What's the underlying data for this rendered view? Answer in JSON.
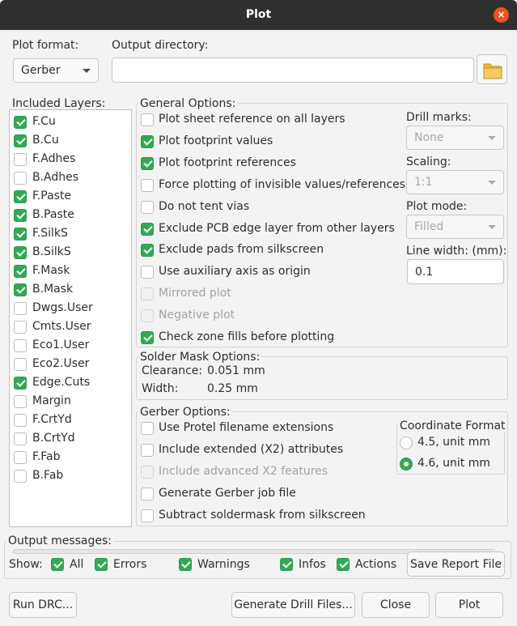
{
  "window": {
    "title": "Plot",
    "close_glyph": "×"
  },
  "plot_format": {
    "label": "Plot format:",
    "value": "Gerber"
  },
  "output_directory": {
    "label": "Output directory:",
    "value": "",
    "browse_icon": "folder-icon"
  },
  "layers": {
    "title": "Included Layers:",
    "items": [
      {
        "label": "F.Cu",
        "checked": true
      },
      {
        "label": "B.Cu",
        "checked": true
      },
      {
        "label": "F.Adhes",
        "checked": false
      },
      {
        "label": "B.Adhes",
        "checked": false
      },
      {
        "label": "F.Paste",
        "checked": true
      },
      {
        "label": "B.Paste",
        "checked": true
      },
      {
        "label": "F.SilkS",
        "checked": true
      },
      {
        "label": "B.SilkS",
        "checked": true
      },
      {
        "label": "F.Mask",
        "checked": true
      },
      {
        "label": "B.Mask",
        "checked": true
      },
      {
        "label": "Dwgs.User",
        "checked": false
      },
      {
        "label": "Cmts.User",
        "checked": false
      },
      {
        "label": "Eco1.User",
        "checked": false
      },
      {
        "label": "Eco2.User",
        "checked": false
      },
      {
        "label": "Edge.Cuts",
        "checked": true
      },
      {
        "label": "Margin",
        "checked": false
      },
      {
        "label": "F.CrtYd",
        "checked": false
      },
      {
        "label": "B.CrtYd",
        "checked": false
      },
      {
        "label": "F.Fab",
        "checked": false
      },
      {
        "label": "B.Fab",
        "checked": false
      }
    ]
  },
  "general": {
    "title": "General Options:",
    "options": [
      {
        "label": "Plot sheet reference on all layers",
        "checked": false,
        "enabled": true
      },
      {
        "label": "Plot footprint values",
        "checked": true,
        "enabled": true
      },
      {
        "label": "Plot footprint references",
        "checked": true,
        "enabled": true
      },
      {
        "label": "Force plotting of invisible values/references",
        "checked": false,
        "enabled": true
      },
      {
        "label": "Do not tent vias",
        "checked": false,
        "enabled": true
      },
      {
        "label": "Exclude PCB edge layer from other layers",
        "checked": true,
        "enabled": true
      },
      {
        "label": "Exclude pads from silkscreen",
        "checked": true,
        "enabled": true
      },
      {
        "label": "Use auxiliary axis as origin",
        "checked": false,
        "enabled": true
      },
      {
        "label": "Mirrored plot",
        "checked": false,
        "enabled": false
      },
      {
        "label": "Negative plot",
        "checked": false,
        "enabled": false
      },
      {
        "label": "Check zone fills before plotting",
        "checked": true,
        "enabled": true
      }
    ],
    "drill_marks": {
      "label": "Drill marks:",
      "value": "None"
    },
    "scaling": {
      "label": "Scaling:",
      "value": "1:1"
    },
    "plot_mode": {
      "label": "Plot mode:",
      "value": "Filled"
    },
    "line_width": {
      "label": "Line width: (mm):",
      "value": "0.1"
    }
  },
  "solder_mask": {
    "title": "Solder Mask Options:",
    "clearance_label": "Clearance:",
    "clearance_value": "0.051 mm",
    "width_label": "Width:",
    "width_value": "0.25 mm"
  },
  "gerber": {
    "title": "Gerber Options:",
    "options": [
      {
        "label": "Use Protel filename extensions",
        "checked": false,
        "enabled": true
      },
      {
        "label": "Include extended (X2) attributes",
        "checked": false,
        "enabled": true
      },
      {
        "label": "Include advanced X2 features",
        "checked": false,
        "enabled": false
      },
      {
        "label": "Generate Gerber job file",
        "checked": false,
        "enabled": true
      },
      {
        "label": "Subtract soldermask from silkscreen",
        "checked": false,
        "enabled": true
      }
    ],
    "coord_format": {
      "title": "Coordinate Format",
      "options": [
        {
          "label": "4.5, unit mm",
          "selected": false
        },
        {
          "label": "4.6, unit mm",
          "selected": true
        }
      ]
    }
  },
  "messages": {
    "title": "Output messages:",
    "show_label": "Show:",
    "filters": [
      {
        "label": "All",
        "checked": true
      },
      {
        "label": "Errors",
        "checked": true
      },
      {
        "label": "Warnings",
        "checked": true
      },
      {
        "label": "Infos",
        "checked": true
      },
      {
        "label": "Actions",
        "checked": true
      }
    ],
    "save_button": "Save Report File"
  },
  "buttons": {
    "run_drc": "Run DRC...",
    "generate_drill": "Generate Drill Files...",
    "close": "Close",
    "plot": "Plot"
  },
  "colors": {
    "accent": "#33a956",
    "titlebar": "#2f2f2f",
    "close": "#e9541f"
  }
}
